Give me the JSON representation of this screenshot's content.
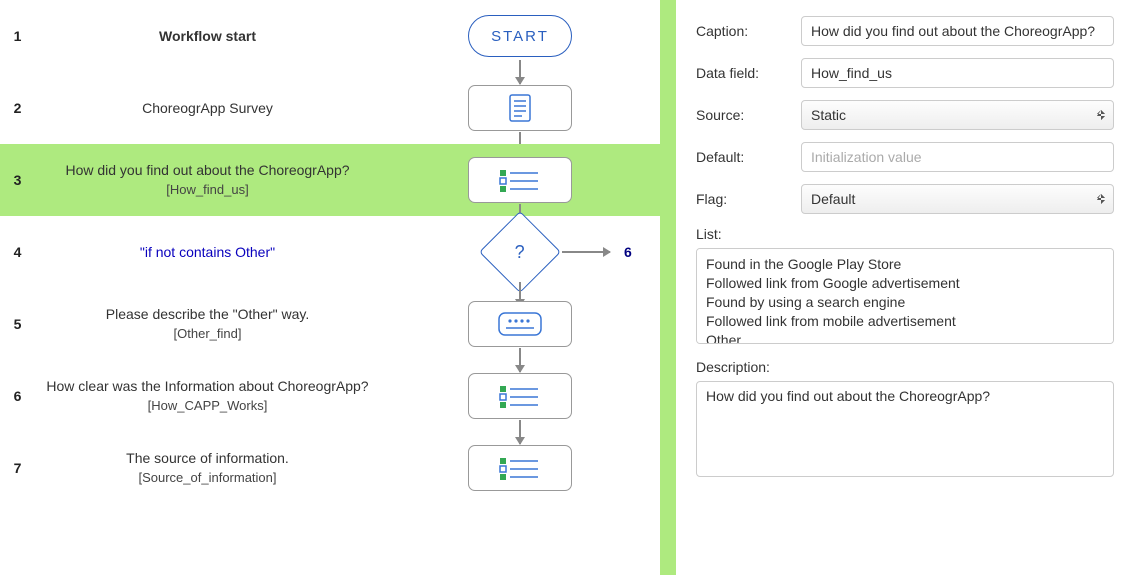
{
  "flow": {
    "rows": [
      {
        "num": "1",
        "label": "Workflow start",
        "field": "",
        "type": "start",
        "start_text": "START",
        "bold": true
      },
      {
        "num": "2",
        "label": "ChoreogrApp Survey",
        "field": "",
        "type": "doc"
      },
      {
        "num": "3",
        "label": "How did you find out about the ChoreogrApp?",
        "field": "[How_find_us]",
        "type": "list",
        "highlight": true
      },
      {
        "num": "4",
        "label": "\"if not contains Other\"",
        "field": "",
        "type": "diamond",
        "blue": true,
        "jump": "6",
        "qmark": "?"
      },
      {
        "num": "5",
        "label": "Please describe the \"Other\" way.",
        "field": "[Other_find]",
        "type": "text"
      },
      {
        "num": "6",
        "label": "How clear was the Information about ChoreogrApp?",
        "field": "[How_CAPP_Works]",
        "type": "list"
      },
      {
        "num": "7",
        "label": "The source of information.",
        "field": "[Source_of_information]",
        "type": "list"
      }
    ]
  },
  "form": {
    "caption_label": "Caption:",
    "caption_value": "How did you find out about the ChoreogrApp?",
    "data_field_label": "Data field:",
    "data_field_value": "How_find_us",
    "source_label": "Source:",
    "source_value": "Static",
    "default_label": "Default:",
    "default_placeholder": "Initialization value",
    "flag_label": "Flag:",
    "flag_value": "Default",
    "list_label": "List:",
    "list_value": "Found in the Google Play Store\nFollowed link from Google advertisement\nFound by using a search engine\nFollowed link from mobile advertisement\nOther",
    "description_label": "Description:",
    "description_value": "How did you find out about the ChoreogrApp?"
  }
}
